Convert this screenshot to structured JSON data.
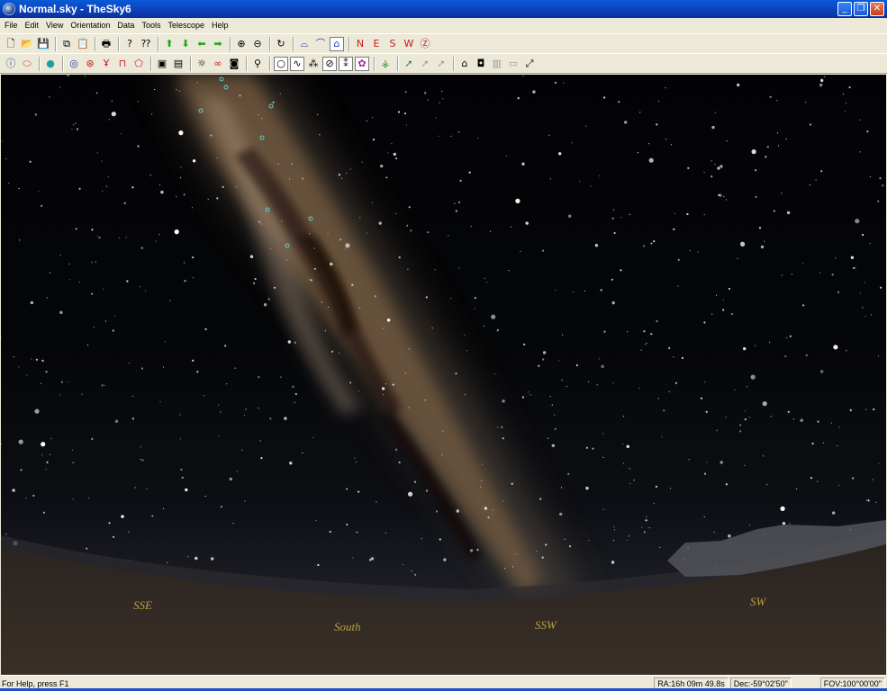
{
  "window": {
    "title": "Normal.sky - TheSky6",
    "minimize_glyph": "_",
    "restore_glyph": "❐",
    "close_glyph": "✕"
  },
  "menu": [
    "File",
    "Edit",
    "View",
    "Orientation",
    "Data",
    "Tools",
    "Telescope",
    "Help"
  ],
  "toolbar1": [
    {
      "icon": "new-file-icon",
      "glyph": "🗋"
    },
    {
      "icon": "open-folder-icon",
      "glyph": "📂"
    },
    {
      "icon": "save-icon",
      "glyph": "💾"
    },
    {
      "sep": true
    },
    {
      "icon": "copy-icon",
      "glyph": "⧉"
    },
    {
      "icon": "paste-icon",
      "glyph": "📋"
    },
    {
      "sep": true
    },
    {
      "icon": "print-icon",
      "glyph": "🖶"
    },
    {
      "sep": true
    },
    {
      "icon": "help-icon",
      "glyph": "?"
    },
    {
      "icon": "context-help-icon",
      "glyph": "⁇"
    },
    {
      "sep": true
    },
    {
      "icon": "arrow-up-icon",
      "glyph": "⬆",
      "color": "#1fa51f"
    },
    {
      "icon": "arrow-down-icon",
      "glyph": "⬇",
      "color": "#1fa51f"
    },
    {
      "icon": "arrow-left-icon",
      "glyph": "⬅",
      "color": "#1fa51f"
    },
    {
      "icon": "arrow-right-icon",
      "glyph": "➡",
      "color": "#1fa51f"
    },
    {
      "sep": true
    },
    {
      "icon": "zoom-in-icon",
      "glyph": "⊕"
    },
    {
      "icon": "zoom-out-icon",
      "glyph": "⊖"
    },
    {
      "sep": true
    },
    {
      "icon": "rotate-icon",
      "glyph": "↻"
    },
    {
      "sep": true
    },
    {
      "icon": "horizon-view-icon",
      "glyph": "⌓",
      "color": "#2040b0"
    },
    {
      "icon": "zenith-view-icon",
      "glyph": "⌒",
      "color": "#2040b0"
    },
    {
      "icon": "sky-view-icon",
      "glyph": "⌂",
      "color": "#2040b0",
      "pressed": true
    },
    {
      "sep": true
    },
    {
      "icon": "look-north-icon",
      "glyph": "N",
      "color": "#c02020"
    },
    {
      "icon": "look-east-icon",
      "glyph": "E",
      "color": "#c02020"
    },
    {
      "icon": "look-south-icon",
      "glyph": "S",
      "color": "#c02020"
    },
    {
      "icon": "look-west-icon",
      "glyph": "W",
      "color": "#c02020"
    },
    {
      "icon": "look-zenith-icon",
      "glyph": "Ⓩ",
      "color": "#c02020"
    }
  ],
  "toolbar2": [
    {
      "icon": "info-icon",
      "glyph": "ⓘ",
      "color": "#2040b0"
    },
    {
      "icon": "ecliptic-icon",
      "glyph": "⬭",
      "color": "#c04010"
    },
    {
      "sep": true
    },
    {
      "icon": "planet-icon",
      "glyph": "●",
      "color": "#20a0a0"
    },
    {
      "sep": true
    },
    {
      "icon": "galaxy-icon",
      "glyph": "◎",
      "color": "#2040b0"
    },
    {
      "icon": "globe-grid-icon",
      "glyph": "⊛",
      "color": "#c02020"
    },
    {
      "icon": "constellation-icon",
      "glyph": "Ұ",
      "color": "#c02020"
    },
    {
      "icon": "telescope-mount-icon",
      "glyph": "⊓",
      "color": "#c02020"
    },
    {
      "icon": "horizon-object-icon",
      "glyph": "⬠",
      "color": "#c02020"
    },
    {
      "sep": true
    },
    {
      "icon": "photo-icon",
      "glyph": "▣"
    },
    {
      "icon": "image-overlay-icon",
      "glyph": "▤"
    },
    {
      "sep": true
    },
    {
      "icon": "sun-icon",
      "glyph": "☼"
    },
    {
      "icon": "binocular-red-icon",
      "glyph": "∞",
      "color": "#c02020"
    },
    {
      "icon": "camera-icon",
      "glyph": "◙"
    },
    {
      "sep": true
    },
    {
      "icon": "binoculars-icon",
      "glyph": "⚲"
    },
    {
      "sep": true
    },
    {
      "icon": "star-circle-icon",
      "glyph": "○",
      "pressed": true
    },
    {
      "icon": "star-link-icon",
      "glyph": "∿",
      "pressed": true
    },
    {
      "icon": "star-cluster-icon",
      "glyph": "⁂"
    },
    {
      "icon": "orbit-icon",
      "glyph": "⊘",
      "pressed": true
    },
    {
      "icon": "pattern-icon",
      "glyph": "⁑",
      "pressed": true
    },
    {
      "icon": "nebula-icon",
      "glyph": "✿",
      "color": "#a020a0",
      "pressed": true
    },
    {
      "sep": true
    },
    {
      "icon": "telescope-icon",
      "glyph": "⚶",
      "color": "#1f8a1f"
    },
    {
      "sep": true
    },
    {
      "icon": "slew-icon",
      "glyph": "➚",
      "color": "#1f8a1f"
    },
    {
      "icon": "slew-disabled-icon",
      "glyph": "➚",
      "color": "#9a9a9a"
    },
    {
      "icon": "sync-disabled-icon",
      "glyph": "➚",
      "color": "#9a9a9a"
    },
    {
      "sep": true
    },
    {
      "icon": "dome-icon",
      "glyph": "⌂"
    },
    {
      "icon": "camera-control-icon",
      "glyph": "◘"
    },
    {
      "icon": "focuser-icon",
      "glyph": "▥",
      "color": "#9a9a9a"
    },
    {
      "icon": "filter-icon",
      "glyph": "▭",
      "color": "#9a9a9a"
    },
    {
      "icon": "autoguide-icon",
      "glyph": "⤢"
    }
  ],
  "compass_labels": [
    "SSE",
    "South",
    "SSW",
    "SW"
  ],
  "status": {
    "help": "For Help, press F1",
    "ra": "RA:16h 09m 49.8s",
    "dec": "Dec:-59°02'50\"",
    "fov": "FOV:100°00'00\""
  }
}
